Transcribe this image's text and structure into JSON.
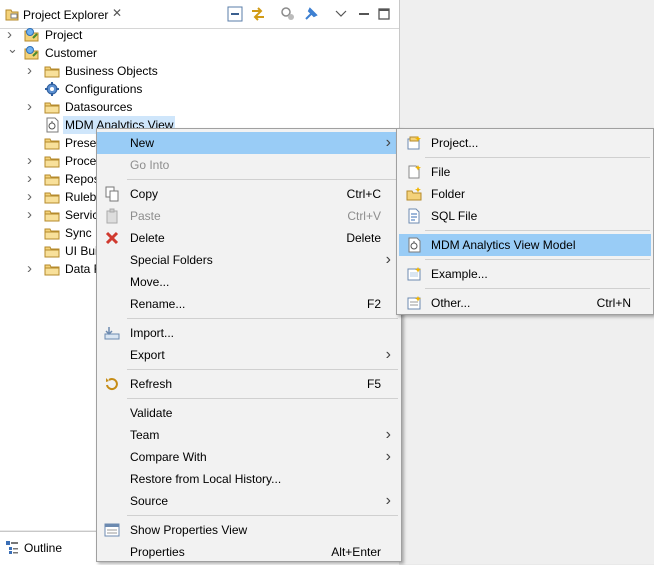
{
  "explorer": {
    "title": "Project Explorer",
    "close_glyph": "✕",
    "toolbar_icons": [
      "collapse-all-icon",
      "link-editor-icon",
      "filter-icon",
      "pin-icon",
      "view-menu-icon",
      "minimize-icon",
      "maximize-icon"
    ]
  },
  "tree": [
    {
      "label": "Project",
      "icon": "project-icon",
      "expanded": false,
      "indent": 0
    },
    {
      "label": "Customer",
      "icon": "project-icon",
      "expanded": true,
      "indent": 0
    },
    {
      "label": "Business Objects",
      "icon": "folder-icon",
      "expanded": false,
      "indent": 1
    },
    {
      "label": "Configurations",
      "icon": "gear-icon",
      "expanded": null,
      "indent": 1
    },
    {
      "label": "Datasources",
      "icon": "folder-icon",
      "expanded": false,
      "indent": 1
    },
    {
      "label": "MDM Analytics View",
      "icon": "analytics-view-icon",
      "expanded": null,
      "indent": 1,
      "selected": true
    },
    {
      "label": "Presen",
      "icon": "folder-icon",
      "expanded": null,
      "indent": 1
    },
    {
      "label": "Proce",
      "icon": "folder-icon",
      "expanded": false,
      "indent": 1
    },
    {
      "label": "Repos",
      "icon": "folder-icon",
      "expanded": false,
      "indent": 1
    },
    {
      "label": "Ruleb",
      "icon": "folder-icon",
      "expanded": false,
      "indent": 1
    },
    {
      "label": "Servic",
      "icon": "folder-icon",
      "expanded": false,
      "indent": 1
    },
    {
      "label": "Sync I",
      "icon": "folder-icon",
      "expanded": null,
      "indent": 1
    },
    {
      "label": "UI Bui",
      "icon": "folder-icon",
      "expanded": null,
      "indent": 1
    },
    {
      "label": "Data F",
      "icon": "folder-icon",
      "expanded": false,
      "indent": 1
    }
  ],
  "outline": {
    "title": "Outline"
  },
  "context_menu": {
    "items": [
      {
        "label": "New",
        "submenu": true,
        "highlighted": true
      },
      {
        "label": "Go Into",
        "disabled": true
      },
      {
        "sep": true
      },
      {
        "label": "Copy",
        "shortcut": "Ctrl+C",
        "icon": "copy-icon"
      },
      {
        "label": "Paste",
        "shortcut": "Ctrl+V",
        "icon": "paste-icon",
        "disabled": true
      },
      {
        "label": "Delete",
        "shortcut": "Delete",
        "icon": "delete-icon"
      },
      {
        "label": "Special Folders",
        "submenu": true
      },
      {
        "label": "Move..."
      },
      {
        "label": "Rename...",
        "shortcut": "F2"
      },
      {
        "sep": true
      },
      {
        "label": "Import...",
        "icon": "import-icon"
      },
      {
        "label": "Export",
        "submenu": true
      },
      {
        "sep": true
      },
      {
        "label": "Refresh",
        "shortcut": "F5",
        "icon": "refresh-icon"
      },
      {
        "sep": true
      },
      {
        "label": "Validate"
      },
      {
        "label": "Team",
        "submenu": true
      },
      {
        "label": "Compare With",
        "submenu": true
      },
      {
        "label": "Restore from Local History..."
      },
      {
        "label": "Source",
        "submenu": true
      },
      {
        "sep": true
      },
      {
        "label": "Show Properties View",
        "icon": "properties-view-icon"
      },
      {
        "label": "Properties",
        "shortcut": "Alt+Enter"
      }
    ]
  },
  "submenu_new": {
    "items": [
      {
        "label": "Project...",
        "icon": "new-project-icon"
      },
      {
        "sep": true
      },
      {
        "label": "File",
        "icon": "new-file-icon"
      },
      {
        "label": "Folder",
        "icon": "new-folder-icon"
      },
      {
        "label": "SQL File",
        "icon": "sql-file-icon"
      },
      {
        "sep": true
      },
      {
        "label": "MDM Analytics View Model",
        "icon": "analytics-view-icon",
        "highlighted": true
      },
      {
        "sep": true
      },
      {
        "label": "Example...",
        "icon": "example-icon"
      },
      {
        "sep": true
      },
      {
        "label": "Other...",
        "shortcut": "Ctrl+N",
        "icon": "other-wizard-icon"
      }
    ]
  }
}
